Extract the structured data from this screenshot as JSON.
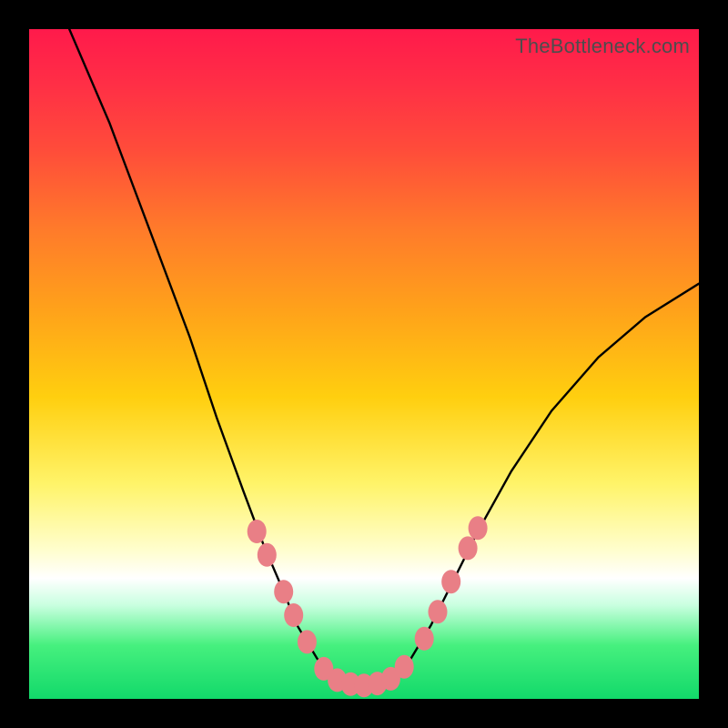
{
  "watermark": "TheBottleneck.com",
  "chart_data": {
    "type": "line",
    "title": "",
    "xlabel": "",
    "ylabel": "",
    "xlim": [
      0,
      100
    ],
    "ylim": [
      0,
      100
    ],
    "series": [
      {
        "name": "curve",
        "x": [
          6,
          12,
          18,
          24,
          28,
          32,
          35,
          38,
          40,
          43,
          46,
          50,
          54,
          57,
          60,
          63,
          67,
          72,
          78,
          85,
          92,
          100
        ],
        "y": [
          100,
          86,
          70,
          54,
          42,
          31,
          23,
          16,
          11,
          6,
          3,
          2,
          3,
          6,
          11,
          17,
          25,
          34,
          43,
          51,
          57,
          62
        ]
      }
    ],
    "markers": {
      "name": "dots",
      "color": "#e97f86",
      "points": [
        {
          "x": 34,
          "y": 25
        },
        {
          "x": 35.5,
          "y": 21.5
        },
        {
          "x": 38,
          "y": 16
        },
        {
          "x": 39.5,
          "y": 12.5
        },
        {
          "x": 41.5,
          "y": 8.5
        },
        {
          "x": 44,
          "y": 4.5
        },
        {
          "x": 46,
          "y": 2.8
        },
        {
          "x": 48,
          "y": 2.2
        },
        {
          "x": 50,
          "y": 2
        },
        {
          "x": 52,
          "y": 2.3
        },
        {
          "x": 54,
          "y": 3
        },
        {
          "x": 56,
          "y": 4.8
        },
        {
          "x": 59,
          "y": 9
        },
        {
          "x": 61,
          "y": 13
        },
        {
          "x": 63,
          "y": 17.5
        },
        {
          "x": 65.5,
          "y": 22.5
        },
        {
          "x": 67,
          "y": 25.5
        }
      ]
    },
    "background_gradient": {
      "top": "#ff1a4b",
      "mid": "#ffe24d",
      "bottom": "#12d96a"
    }
  }
}
